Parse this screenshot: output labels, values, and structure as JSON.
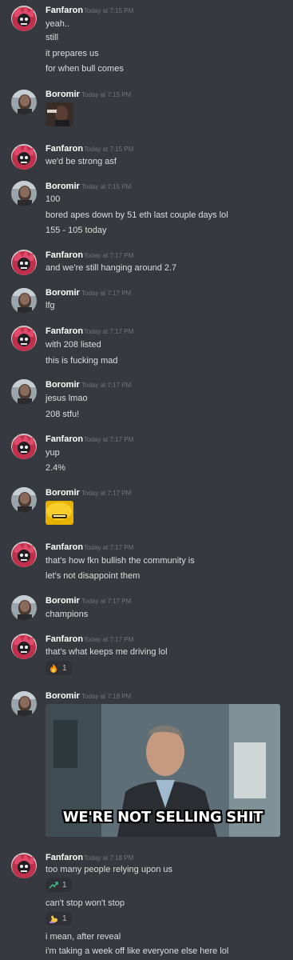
{
  "users": {
    "fanfaron": "Fanfaron",
    "boromir": "Boromir"
  },
  "messages": [
    {
      "author": "Fanfaron",
      "time": "Today at 7:15 PM",
      "lines": [
        "yeah..",
        "still",
        "it prepares us",
        "for when bull comes"
      ]
    },
    {
      "author": "Boromir",
      "time": "Today at 7:15 PM",
      "emoji": "pointing-man-emote",
      "lines": []
    },
    {
      "author": "Fanfaron",
      "time": "Today at 7:15 PM",
      "lines": [
        "we'd be strong asf"
      ]
    },
    {
      "author": "Boromir",
      "time": "Today at 7:15 PM",
      "lines": [
        "100",
        "bored apes down by 51 eth last couple days lol",
        "155 - 105 today"
      ]
    },
    {
      "author": "Fanfaron",
      "time": "Today at 7:17 PM",
      "lines": [
        "and we're still hanging around 2.7"
      ]
    },
    {
      "author": "Boromir",
      "time": "Today at 7:17 PM",
      "lines": [
        "lfg"
      ]
    },
    {
      "author": "Fanfaron",
      "time": "Today at 7:17 PM",
      "lines": [
        "with 208 listed",
        "this is fucking mad"
      ]
    },
    {
      "author": "Boromir",
      "time": "Today at 7:17 PM",
      "lines": [
        "jesus lmao",
        "208 stfu!"
      ]
    },
    {
      "author": "Fanfaron",
      "time": "Today at 7:17 PM",
      "lines": [
        "yup",
        "2.4%"
      ]
    },
    {
      "author": "Boromir",
      "time": "Today at 7:17 PM",
      "emoji": "gold-mouth-emote",
      "lines": []
    },
    {
      "author": "Fanfaron",
      "time": "Today at 7:17 PM",
      "lines": [
        "that's how fkn bullish the community is",
        "let's not disappoint them"
      ]
    },
    {
      "author": "Boromir",
      "time": "Today at 7:17 PM",
      "lines": [
        "champions"
      ]
    },
    {
      "author": "Fanfaron",
      "time": "Today at 7:17 PM",
      "lines": [
        "that's what keeps me driving lol"
      ],
      "reaction": {
        "icon": "fire-icon",
        "count": "1"
      }
    },
    {
      "author": "Boromir",
      "time": "Today at 7:18 PM",
      "image_caption": "WE'RE NOT SELLING SHIT",
      "lines": []
    },
    {
      "author": "Fanfaron",
      "time": "Today at 7:18 PM",
      "lines": [
        "too many people relying upon us",
        "can't stop won't stop",
        "i mean, after reveal",
        "i'm taking a week off like everyone else here lol"
      ],
      "reactions": [
        {
          "icon": "chart-up-icon",
          "count": "1"
        },
        {
          "icon": "flex-icon",
          "count": "1"
        }
      ]
    }
  ],
  "colors": {
    "background": "#36393f",
    "author": "#ffffff",
    "timestamp": "#72767d",
    "text": "#dcddde",
    "reaction_bg": "#2f3136"
  }
}
